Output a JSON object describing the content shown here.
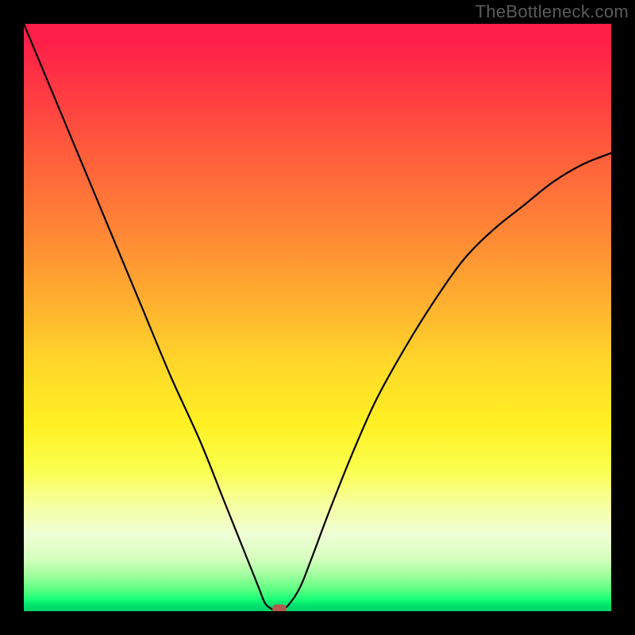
{
  "watermark": "TheBottleneck.com",
  "colors": {
    "page_bg": "#000000",
    "curve": "#000000",
    "marker": "#b55a4f",
    "gradient_top": "#ff1f49",
    "gradient_bottom": "#00d26a",
    "watermark_text": "#5b5b5b"
  },
  "chart_data": {
    "type": "line",
    "title": "",
    "xlabel": "",
    "ylabel": "",
    "xlim": [
      0,
      100
    ],
    "ylim": [
      0,
      100
    ],
    "grid": false,
    "annotations": [],
    "series": [
      {
        "name": "bottleneck-curve",
        "x": [
          0,
          5,
          10,
          15,
          20,
          25,
          30,
          34,
          38,
          40,
          41,
          42,
          43.5,
          45,
          47,
          49,
          52,
          56,
          60,
          65,
          70,
          75,
          80,
          85,
          90,
          95,
          100
        ],
        "values": [
          100,
          88,
          76,
          64,
          52,
          40,
          29,
          19,
          9,
          4,
          1.5,
          0.5,
          0,
          1,
          4,
          9,
          17,
          27,
          36,
          45,
          53,
          60,
          65,
          69,
          73,
          76,
          78
        ]
      }
    ],
    "marker": {
      "x": 43.5,
      "y": 0
    }
  }
}
